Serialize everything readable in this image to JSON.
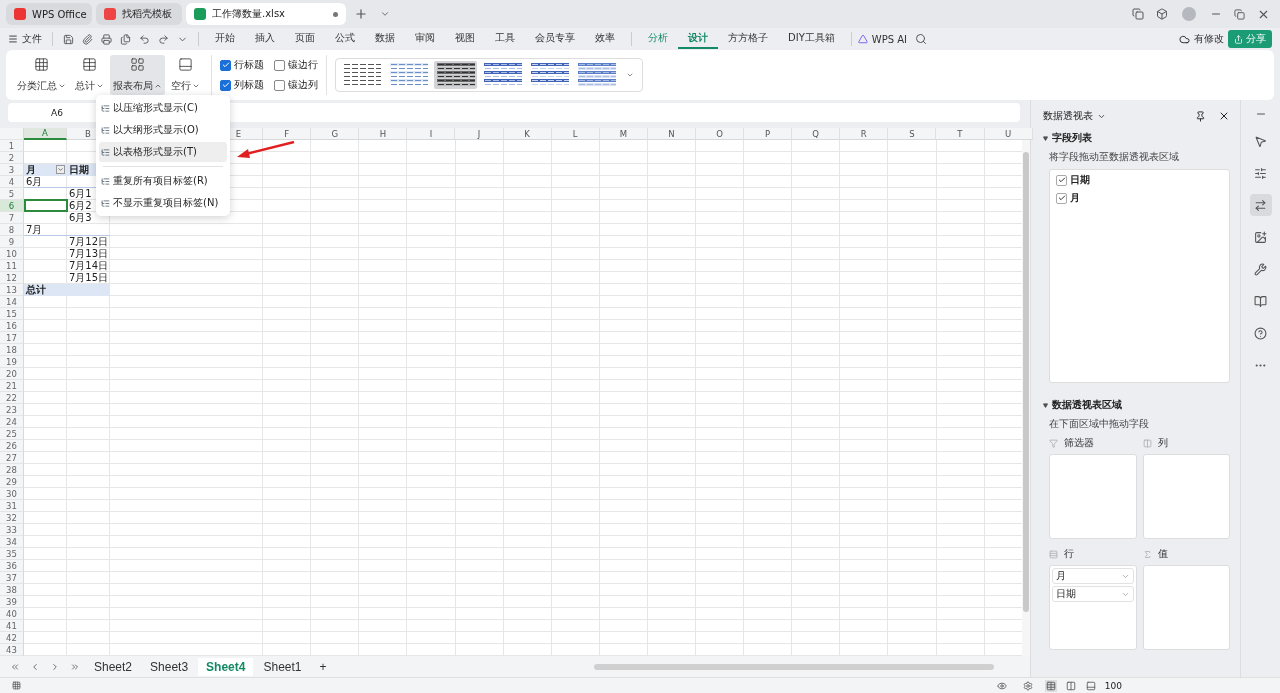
{
  "tabs": [
    {
      "label": "WPS Office",
      "kind": "wps",
      "selected": false
    },
    {
      "label": "找稻壳模板",
      "kind": "docer",
      "selected": false
    },
    {
      "label": "工作簿数量.xlsx",
      "kind": "sheet",
      "selected": true
    }
  ],
  "menu": {
    "file": "文件",
    "tabs": [
      {
        "label": "开始",
        "contextual": false,
        "selected": false
      },
      {
        "label": "插入",
        "contextual": false,
        "selected": false
      },
      {
        "label": "页面",
        "contextual": false,
        "selected": false
      },
      {
        "label": "公式",
        "contextual": false,
        "selected": false
      },
      {
        "label": "数据",
        "contextual": false,
        "selected": false
      },
      {
        "label": "审阅",
        "contextual": false,
        "selected": false
      },
      {
        "label": "视图",
        "contextual": false,
        "selected": false
      },
      {
        "label": "工具",
        "contextual": false,
        "selected": false
      },
      {
        "label": "会员专享",
        "contextual": false,
        "selected": false
      },
      {
        "label": "效率",
        "contextual": false,
        "selected": false
      },
      {
        "label": "分析",
        "contextual": true,
        "selected": false
      },
      {
        "label": "设计",
        "contextual": true,
        "selected": true
      },
      {
        "label": "方方格子",
        "contextual": false,
        "selected": false
      },
      {
        "label": "DIY工具箱",
        "contextual": false,
        "selected": false
      }
    ],
    "ai": "WPS AI",
    "modified": "有修改",
    "share": "分享"
  },
  "ribbon": {
    "buttons": [
      {
        "label": "分类汇总",
        "kind": "subtotal",
        "selected": false
      },
      {
        "label": "总计",
        "kind": "total",
        "selected": false
      },
      {
        "label": "报表布局",
        "kind": "layout",
        "selected": true
      },
      {
        "label": "空行",
        "kind": "blank",
        "selected": false
      }
    ],
    "checkboxes": [
      {
        "label": "行标题",
        "checked": true
      },
      {
        "label": "镶边行",
        "checked": false
      },
      {
        "label": "列标题",
        "checked": true
      },
      {
        "label": "镶边列",
        "checked": false
      }
    ],
    "styles": [
      {
        "kind": "plain",
        "selected": false
      },
      {
        "kind": "light",
        "selected": false
      },
      {
        "kind": "dark",
        "selected": true
      },
      {
        "kind": "banded",
        "selected": false
      },
      {
        "kind": "columns",
        "selected": false
      },
      {
        "kind": "medium",
        "selected": false
      }
    ]
  },
  "layout_menu": [
    {
      "label": "以压缩形式显示(C)",
      "kind": "item",
      "selected": false
    },
    {
      "label": "以大纲形式显示(O)",
      "kind": "item",
      "selected": false
    },
    {
      "label": "以表格形式显示(T)",
      "kind": "item",
      "selected": true
    },
    {
      "label": "重复所有项目标签(R)",
      "kind": "item-after-separator",
      "selected": false
    },
    {
      "label": "不显示重复项目标签(N)",
      "kind": "item",
      "selected": false
    }
  ],
  "name_box": "A6",
  "columns": [
    {
      "label": "A",
      "selected": true
    },
    {
      "label": "B",
      "selected": false
    },
    {
      "label": "E",
      "selected": false
    },
    {
      "label": "F",
      "selected": false
    },
    {
      "label": "G",
      "selected": false
    },
    {
      "label": "H",
      "selected": false
    },
    {
      "label": "I",
      "selected": false
    },
    {
      "label": "J",
      "selected": false
    },
    {
      "label": "K",
      "selected": false
    },
    {
      "label": "L",
      "selected": false
    },
    {
      "label": "M",
      "selected": false
    },
    {
      "label": "N",
      "selected": false
    },
    {
      "label": "O",
      "selected": false
    },
    {
      "label": "P",
      "selected": false
    },
    {
      "label": "Q",
      "selected": false
    },
    {
      "label": "R",
      "selected": false
    },
    {
      "label": "S",
      "selected": false
    },
    {
      "label": "T",
      "selected": false
    },
    {
      "label": "U",
      "selected": false
    }
  ],
  "rows": [
    {
      "number": "1",
      "kind": "empty",
      "selected": false
    },
    {
      "number": "2",
      "kind": "empty",
      "selected": false
    },
    {
      "number": "3",
      "kind": "header",
      "cells": [
        "月",
        "日期"
      ],
      "selected": false
    },
    {
      "number": "4",
      "kind": "group",
      "cells": [
        "6月"
      ],
      "selected": false
    },
    {
      "number": "5",
      "kind": "item",
      "cells": [
        "",
        "6月1"
      ],
      "selected": false
    },
    {
      "number": "6",
      "kind": "item",
      "cells": [
        "",
        "6月2"
      ],
      "selected": true
    },
    {
      "number": "7",
      "kind": "item",
      "cells": [
        "",
        "6月3"
      ],
      "selected": false
    },
    {
      "number": "8",
      "kind": "group",
      "cells": [
        "7月"
      ],
      "selected": false
    },
    {
      "number": "9",
      "kind": "item",
      "cells": [
        "",
        "7月12日"
      ],
      "selected": false
    },
    {
      "number": "10",
      "kind": "item",
      "cells": [
        "",
        "7月13日"
      ],
      "selected": false
    },
    {
      "number": "11",
      "kind": "item",
      "cells": [
        "",
        "7月14日"
      ],
      "selected": false
    },
    {
      "number": "12",
      "kind": "item",
      "cells": [
        "",
        "7月15日"
      ],
      "selected": false
    },
    {
      "number": "13",
      "kind": "total",
      "cells": [
        "总计"
      ],
      "selected": false
    },
    {
      "number": "14",
      "kind": "empty",
      "selected": false
    },
    {
      "number": "15",
      "kind": "empty",
      "selected": false
    },
    {
      "number": "16",
      "kind": "empty",
      "selected": false
    },
    {
      "number": "17",
      "kind": "empty",
      "selected": false
    },
    {
      "number": "18",
      "kind": "empty",
      "selected": false
    },
    {
      "number": "19",
      "kind": "empty",
      "selected": false
    },
    {
      "number": "20",
      "kind": "empty",
      "selected": false
    },
    {
      "number": "21",
      "kind": "empty",
      "selected": false
    },
    {
      "number": "22",
      "kind": "empty",
      "selected": false
    },
    {
      "number": "23",
      "kind": "empty",
      "selected": false
    },
    {
      "number": "24",
      "kind": "empty",
      "selected": false
    },
    {
      "number": "25",
      "kind": "empty",
      "selected": false
    },
    {
      "number": "26",
      "kind": "empty",
      "selected": false
    },
    {
      "number": "27",
      "kind": "empty",
      "selected": false
    },
    {
      "number": "28",
      "kind": "empty",
      "selected": false
    },
    {
      "number": "29",
      "kind": "empty",
      "selected": false
    },
    {
      "number": "30",
      "kind": "empty",
      "selected": false
    },
    {
      "number": "31",
      "kind": "empty",
      "selected": false
    },
    {
      "number": "32",
      "kind": "empty",
      "selected": false
    },
    {
      "number": "33",
      "kind": "empty",
      "selected": false
    },
    {
      "number": "34",
      "kind": "empty",
      "selected": false
    },
    {
      "number": "35",
      "kind": "empty",
      "selected": false
    },
    {
      "number": "36",
      "kind": "empty",
      "selected": false
    },
    {
      "number": "37",
      "kind": "empty",
      "selected": false
    },
    {
      "number": "38",
      "kind": "empty",
      "selected": false
    },
    {
      "number": "39",
      "kind": "empty",
      "selected": false
    },
    {
      "number": "40",
      "kind": "empty",
      "selected": false
    },
    {
      "number": "41",
      "kind": "empty",
      "selected": false
    },
    {
      "number": "42",
      "kind": "empty",
      "selected": false
    },
    {
      "number": "43",
      "kind": "empty",
      "selected": false
    }
  ],
  "sheets": [
    {
      "label": "Sheet2",
      "selected": false
    },
    {
      "label": "Sheet3",
      "selected": false
    },
    {
      "label": "Sheet4",
      "selected": true
    },
    {
      "label": "Sheet1",
      "selected": false
    }
  ],
  "add_sheet": "+",
  "pivot_panel": {
    "title": "数据透视表",
    "field_section": "字段列表",
    "field_hint": "将字段拖动至数据透视表区域",
    "fields": [
      {
        "label": "日期",
        "checked": true
      },
      {
        "label": "月",
        "checked": true
      }
    ],
    "area_section": "数据透视表区域",
    "area_hint": "在下面区域中拖动字段",
    "areas": [
      {
        "label": "筛选器",
        "kind": "filter"
      },
      {
        "label": "列",
        "kind": "columns"
      },
      {
        "label": "行",
        "kind": "rows",
        "items": [
          "月",
          "日期"
        ]
      },
      {
        "label": "值",
        "kind": "values"
      }
    ]
  },
  "side_tools": [
    {
      "kind": "cursor",
      "selected": false
    },
    {
      "kind": "sliders",
      "selected": false
    },
    {
      "kind": "pivot",
      "selected": true
    },
    {
      "kind": "image",
      "selected": false
    },
    {
      "kind": "tools",
      "selected": false
    },
    {
      "kind": "book",
      "selected": false
    },
    {
      "kind": "help",
      "selected": false
    },
    {
      "kind": "more",
      "selected": false
    }
  ],
  "zoom": "100"
}
